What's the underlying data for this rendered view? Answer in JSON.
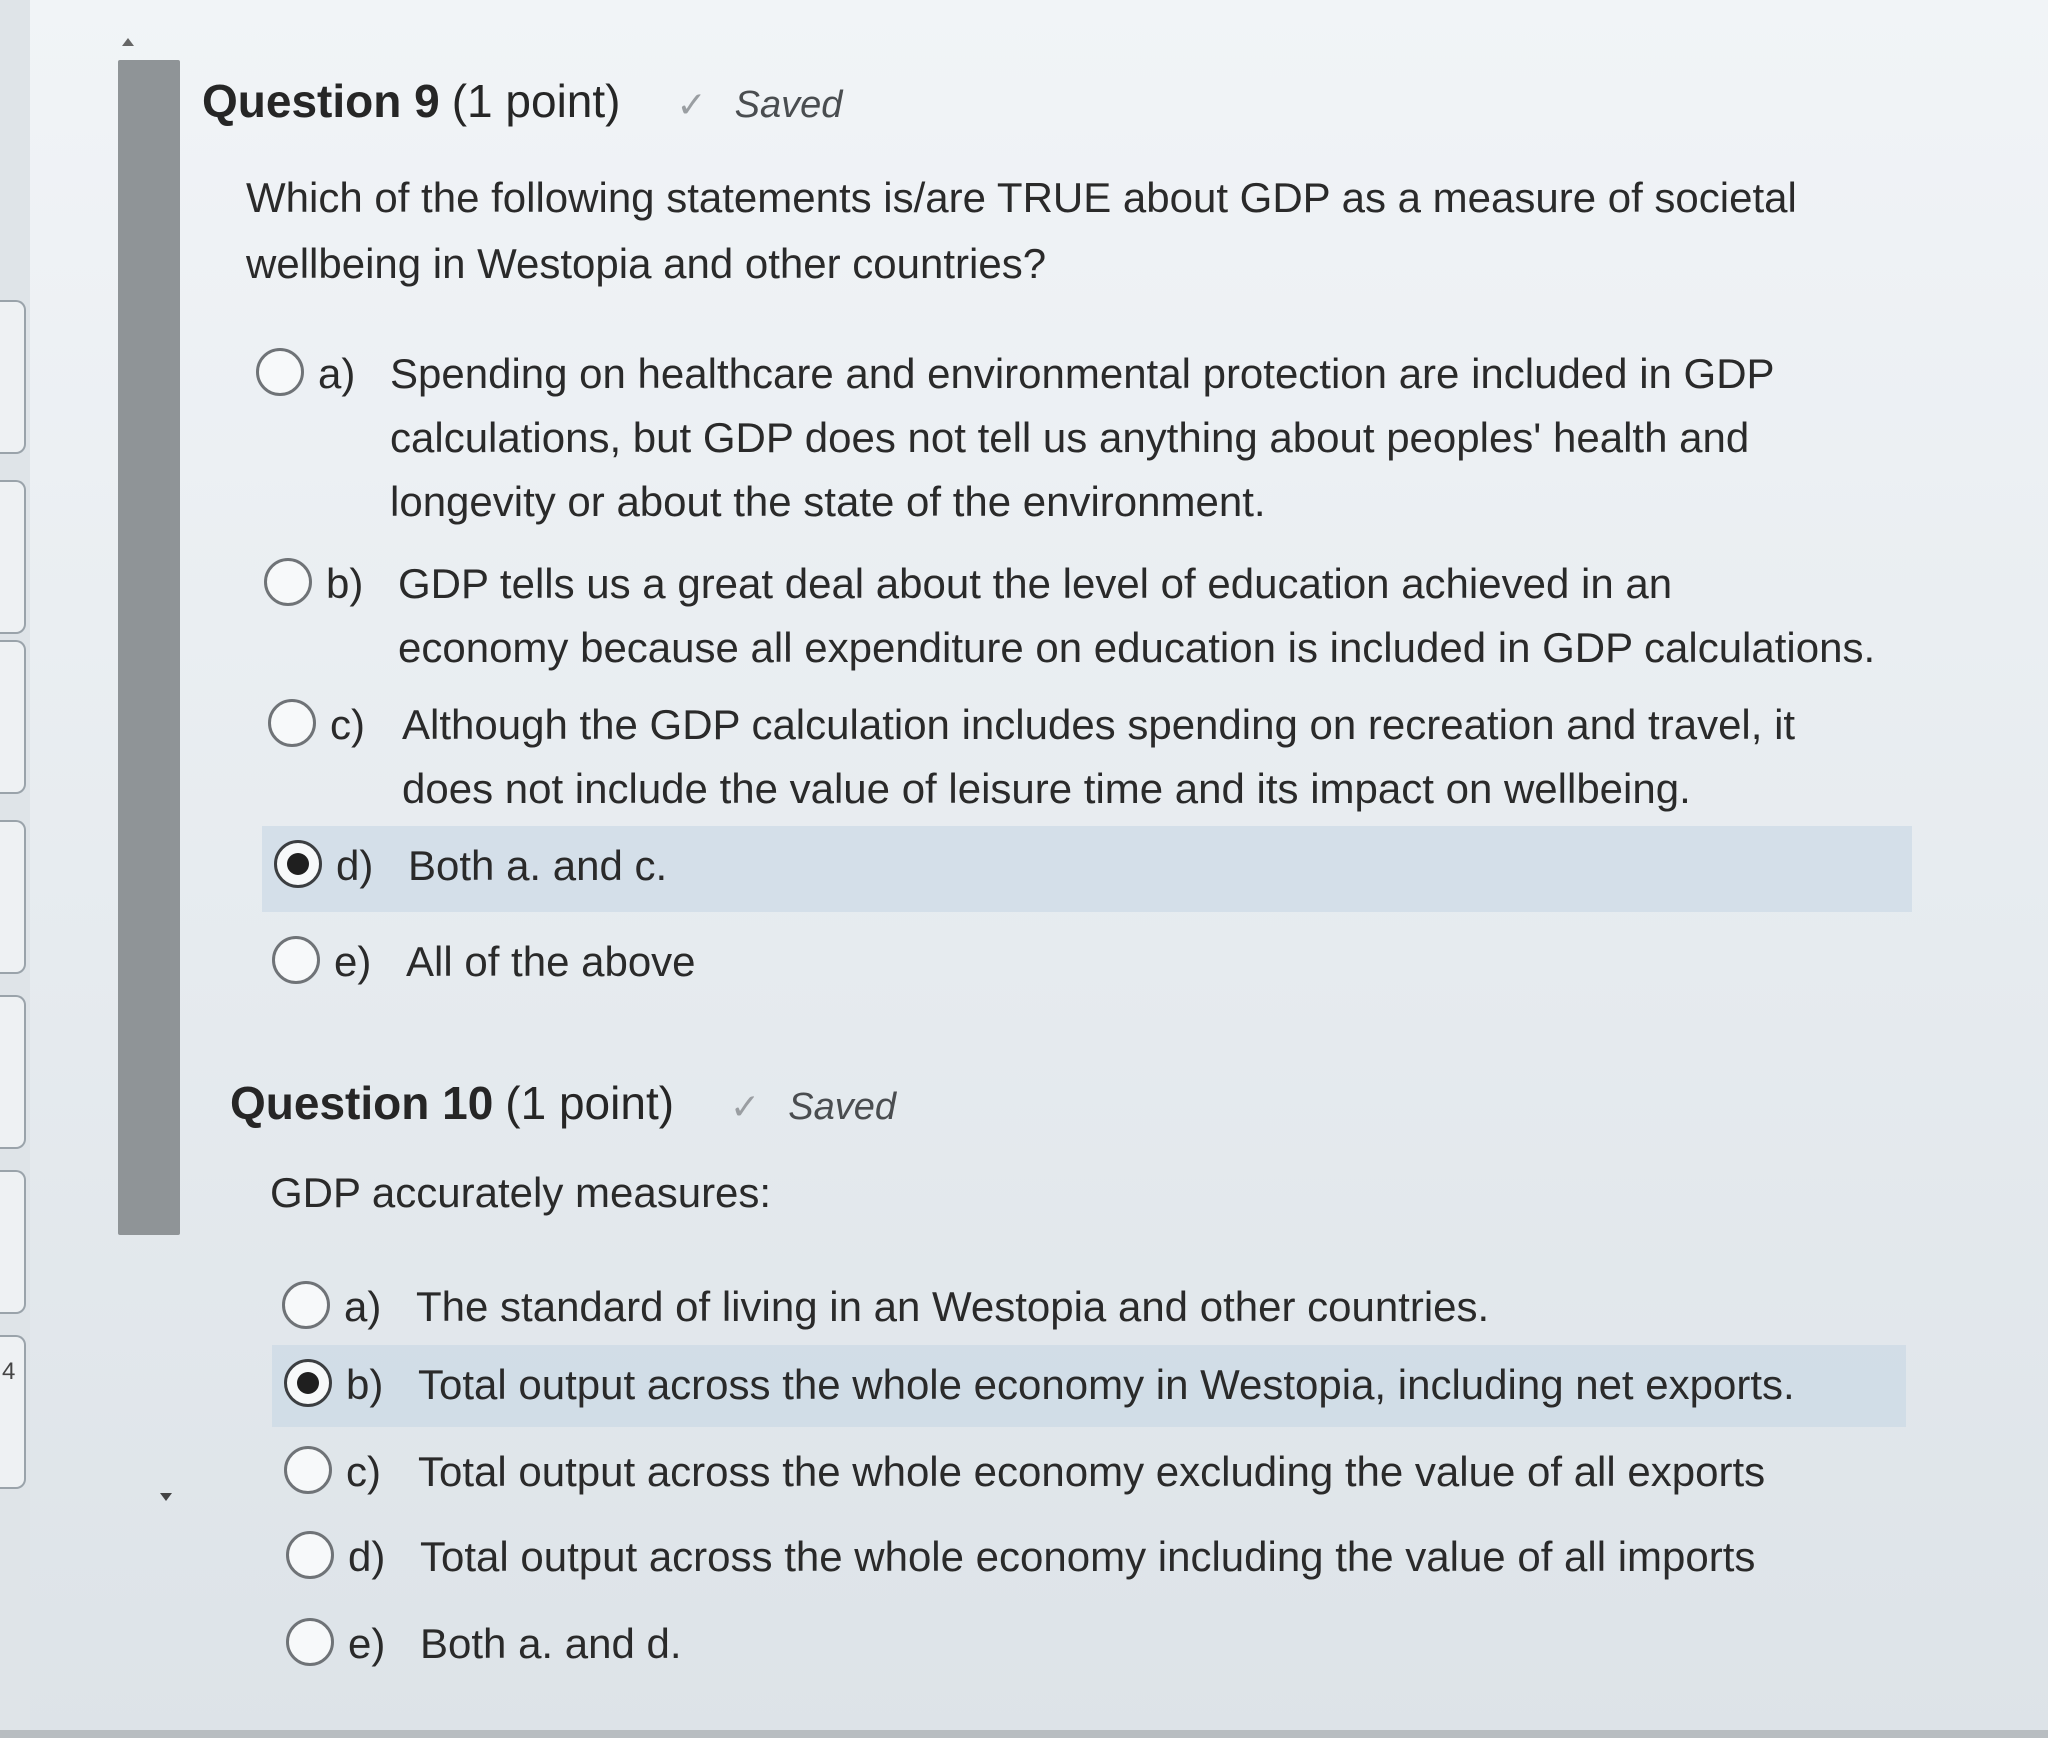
{
  "questions": [
    {
      "title": "Question 9",
      "points": "(1 point)",
      "status": "Saved",
      "prompt_line1": "Which of the following statements is/are TRUE about GDP as a measure of societal",
      "prompt_line2": "wellbeing in Westopia and other countries?",
      "selected": "d",
      "options": [
        {
          "letter": "a)",
          "lines": [
            "Spending on healthcare and environmental protection are included in GDP",
            "calculations, but GDP does not tell us anything about peoples' health and",
            "longevity or about the state of the environment."
          ]
        },
        {
          "letter": "b)",
          "lines": [
            "GDP tells us a great deal about the level of education achieved in an",
            "economy because all expenditure on education is included in GDP calculations."
          ]
        },
        {
          "letter": "c)",
          "lines": [
            "Although the GDP calculation includes spending on recreation and travel, it",
            "does not include the value of leisure time and its impact on wellbeing."
          ]
        },
        {
          "letter": "d)",
          "lines": [
            "Both a. and c."
          ]
        },
        {
          "letter": "e)",
          "lines": [
            "All of the above"
          ]
        }
      ]
    },
    {
      "title": "Question 10",
      "points": "(1 point)",
      "status": "Saved",
      "prompt_line1": "GDP accurately measures:",
      "selected": "b",
      "options": [
        {
          "letter": "a)",
          "lines": [
            "The standard of living in an Westopia and other countries."
          ]
        },
        {
          "letter": "b)",
          "lines": [
            "Total output across the whole economy in Westopia, including net exports."
          ]
        },
        {
          "letter": "c)",
          "lines": [
            "Total output across the whole economy excluding the value of all exports"
          ]
        },
        {
          "letter": "d)",
          "lines": [
            "Total output across the whole economy including the value of all imports"
          ]
        },
        {
          "letter": "e)",
          "lines": [
            "Both a. and d."
          ]
        }
      ]
    }
  ],
  "sidebar": {
    "marker": "4"
  },
  "icons": {
    "check": "check-icon",
    "radio": "radio-button-icon"
  }
}
